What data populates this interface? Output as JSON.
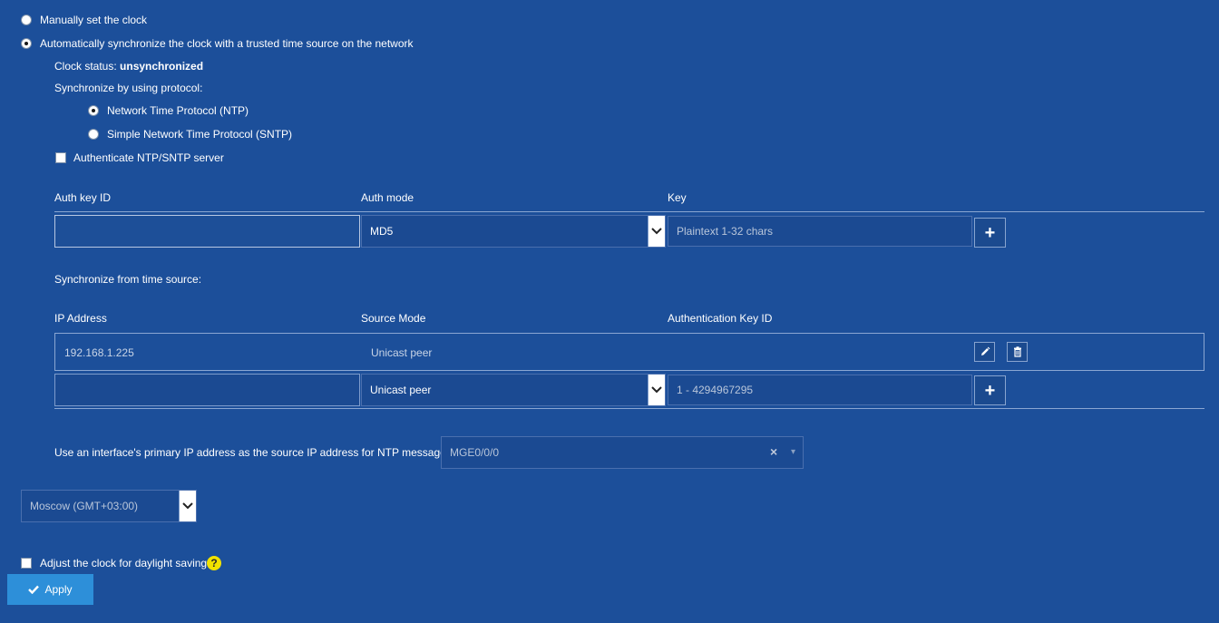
{
  "clock_mode": {
    "manual_label": "Manually set the clock",
    "auto_label": "Automatically synchronize the clock with a trusted time source on the network"
  },
  "status": {
    "prefix": "Clock status: ",
    "value": "unsynchronized"
  },
  "protocol": {
    "heading": "Synchronize by using protocol:",
    "ntp_label": "Network Time Protocol (NTP)",
    "sntp_label": "Simple Network Time Protocol (SNTP)",
    "selected": "ntp"
  },
  "auth": {
    "checkbox_label": "Authenticate NTP/SNTP server",
    "checked": false,
    "columns": [
      "Auth key ID",
      "Auth mode",
      "Key"
    ],
    "key_id_value": "",
    "mode_value": "MD5",
    "key_placeholder": "Plaintext 1-32 chars"
  },
  "sources": {
    "heading": "Synchronize from time source:",
    "columns": [
      "IP Address",
      "Source Mode",
      "Authentication Key ID"
    ],
    "rows": [
      {
        "ip": "192.168.1.225",
        "mode": "Unicast peer",
        "auth_key_id": ""
      }
    ],
    "new_row": {
      "ip_value": "",
      "mode_value": "Unicast peer",
      "key_id_placeholder": "1 - 4294967295"
    }
  },
  "source_interface": {
    "label": "Use an interface's primary IP address as the source IP address for NTP messages.",
    "value": "MGE0/0/0",
    "clear_glyph": "×",
    "arrow_glyph": "▾"
  },
  "timezone": {
    "value": "Moscow (GMT+03:00)"
  },
  "daylight": {
    "label": "Adjust the clock for daylight saving",
    "checked": false,
    "help_glyph": "?"
  },
  "actions": {
    "apply_label": "Apply",
    "plus_glyph": "+"
  },
  "icons": {
    "edit": "pencil-icon",
    "delete": "trash-icon",
    "check": "check-icon",
    "chevron": "chevron-down-icon"
  },
  "colors": {
    "background": "#1c4f9a",
    "apply_button": "#2d8fd9",
    "help_badge": "#f2e200"
  }
}
